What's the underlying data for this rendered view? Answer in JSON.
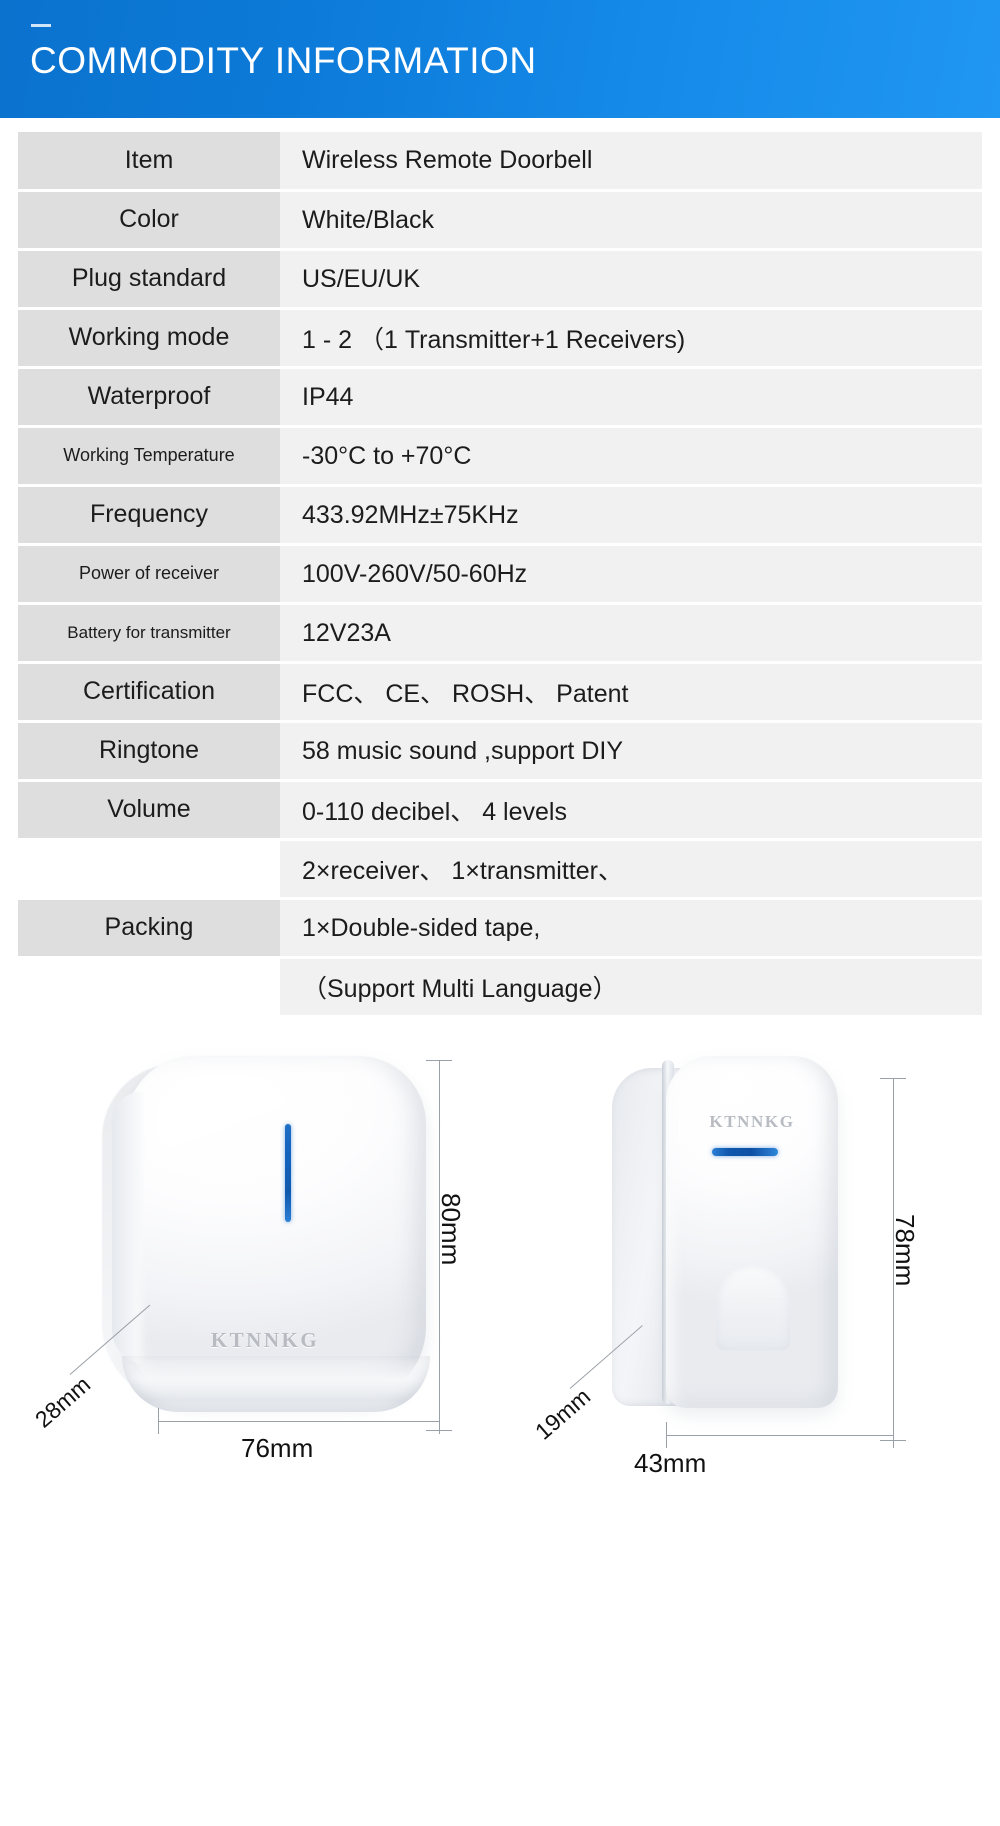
{
  "header": {
    "title": "COMMODITY INFORMATION",
    "accent_dark": "#0b72ce",
    "accent_light": "#2097f2",
    "dash": ""
  },
  "spec_table": {
    "key_bg": "#dedede",
    "value_bg": "#f1f1f1",
    "rows": [
      {
        "key": "Item",
        "value": "Wireless Remote Doorbell",
        "key_size": "normal"
      },
      {
        "key": "Color",
        "value": "White/Black",
        "key_size": "normal"
      },
      {
        "key": "Plug standard",
        "value": "US/EU/UK",
        "key_size": "normal"
      },
      {
        "key": "Working mode",
        "value": "1 - 2 （1 Transmitter+1 Receivers)",
        "key_size": "normal"
      },
      {
        "key": "Waterproof",
        "value": "IP44",
        "key_size": "normal"
      },
      {
        "key": "Working Temperature",
        "value": "-30°C to +70°C",
        "key_size": "small"
      },
      {
        "key": "Frequency",
        "value": "433.92MHz±75KHz",
        "key_size": "normal"
      },
      {
        "key": "Power of  receiver",
        "value": "100V-260V/50-60Hz",
        "key_size": "small"
      },
      {
        "key": "Battery for transmitter",
        "value": "12V23A",
        "key_size": "xsmall"
      },
      {
        "key": "Certification",
        "value": "FCC、 CE、 ROSH、 Patent",
        "key_size": "normal"
      },
      {
        "key": "Ringtone",
        "value": "58 music sound ,support DIY",
        "key_size": "normal"
      },
      {
        "key": "Volume",
        "value": "0-110 decibel、 4 levels",
        "key_size": "normal"
      },
      {
        "key": "",
        "value": "2×receiver、 1×transmitter、",
        "key_size": "blank"
      },
      {
        "key": "Packing",
        "value": "1×Double-sided tape,",
        "key_size": "normal"
      },
      {
        "key": "",
        "value": "（Support Multi Language）",
        "key_size": "blank"
      }
    ]
  },
  "products": {
    "receiver": {
      "brand": "KTNNKG",
      "height_label": "80mm",
      "width_label": "76mm",
      "depth_label": "28mm",
      "led_color": "#1565c0"
    },
    "transmitter": {
      "brand": "KTNNKG",
      "height_label": "78mm",
      "width_label": "43mm",
      "depth_label": "19mm",
      "led_color": "#0f57ad"
    }
  }
}
